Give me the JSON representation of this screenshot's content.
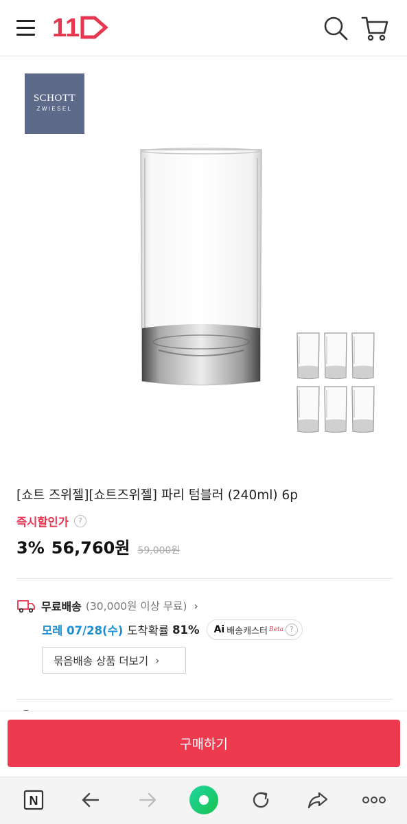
{
  "header": {
    "logo_text": "11",
    "menu_icon": "hamburger-menu-icon",
    "search_icon": "search-icon",
    "cart_icon": "cart-icon",
    "brand_color": "#e8364f"
  },
  "product": {
    "brand_badge": {
      "line1": "SCHOTT",
      "line2": "ZWIESEL",
      "bg_color": "#5e6a89"
    },
    "title": "[쇼트 즈위젤][쇼트즈위젤] 파리 텀블러 (240ml) 6p",
    "instant_discount_label": "즉시할인가",
    "help_icon": "?",
    "discount_rate": "3%",
    "sale_price": "56,760원",
    "original_price": "59,000원"
  },
  "shipping": {
    "label": "무료배송",
    "condition": "(30,000원 이상 무료)",
    "chevron": "›",
    "arrival_date": "모레 07/28(수)",
    "arrival_text": "도착확률",
    "arrival_rate": "81%",
    "ai_caster": {
      "mark": "Ai",
      "text": "배송캐스터",
      "beta": "Beta",
      "help": "?"
    },
    "bundle_button_label": "묶음배송 상품 더보기",
    "bundle_chevron": "›"
  },
  "actions": {
    "buy_button_label": "구매하기",
    "buy_color": "#ee3a4e"
  },
  "nav": {
    "items": [
      {
        "icon": "naver-n-icon",
        "glyph": "N"
      },
      {
        "icon": "back-arrow-icon"
      },
      {
        "icon": "forward-arrow-icon"
      },
      {
        "icon": "green-home-circle-icon"
      },
      {
        "icon": "refresh-icon"
      },
      {
        "icon": "share-icon"
      },
      {
        "icon": "more-dots-icon",
        "glyph": "ooo"
      }
    ]
  }
}
